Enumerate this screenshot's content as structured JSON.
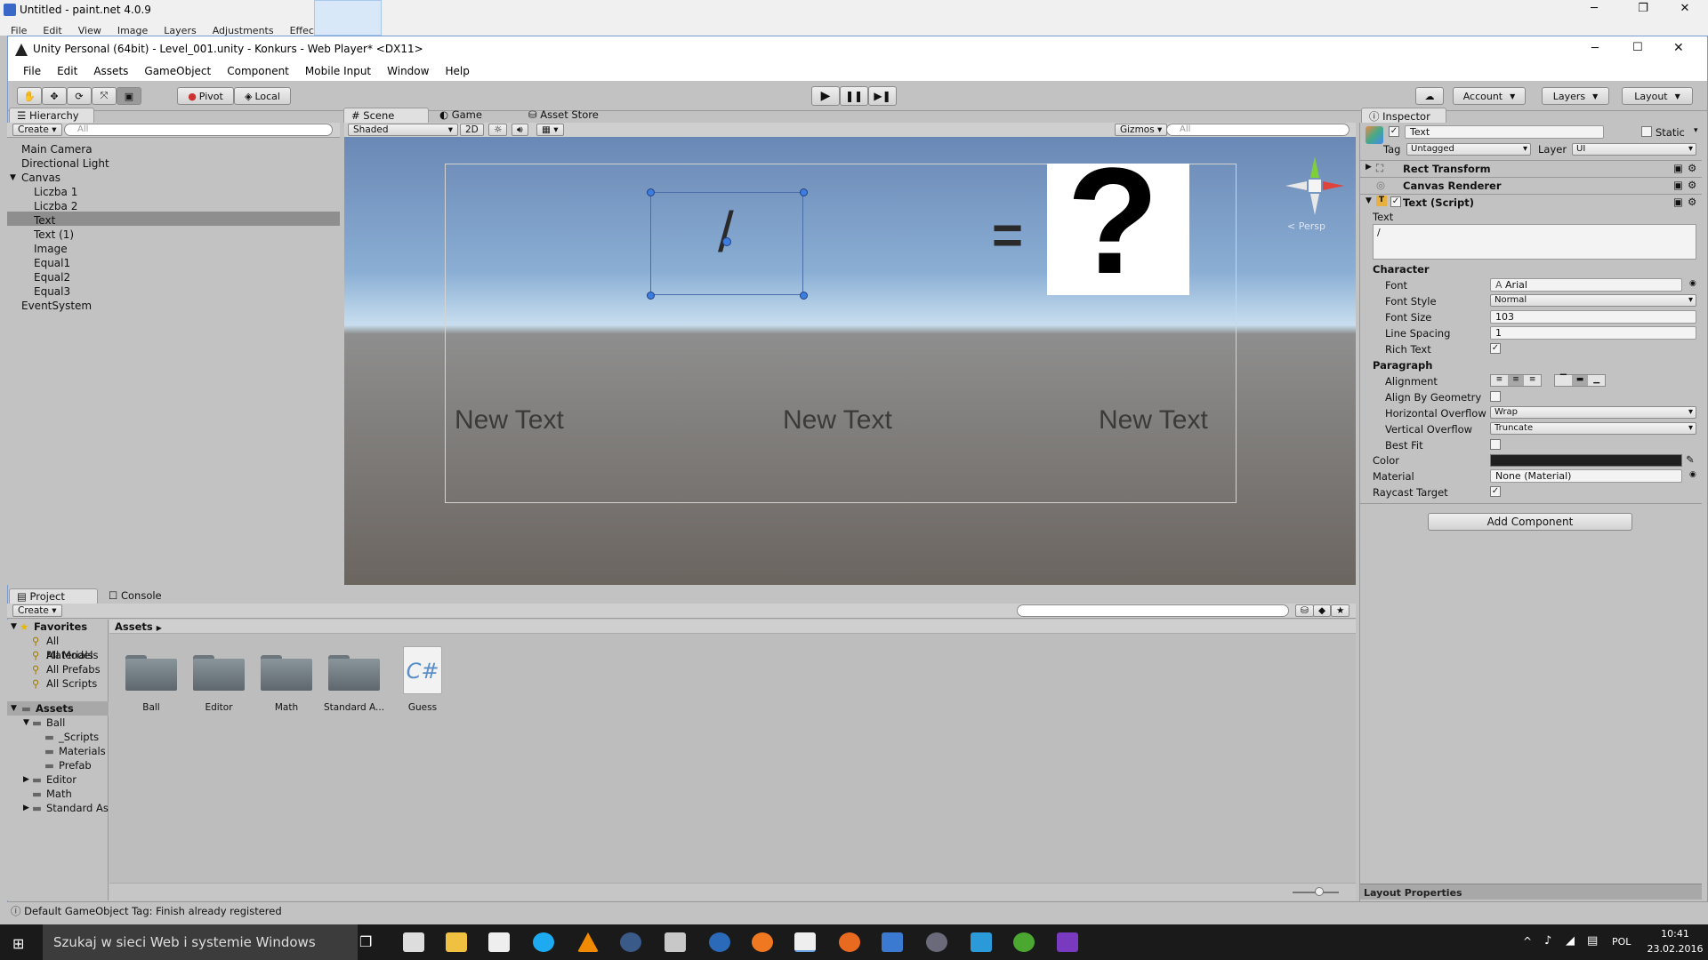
{
  "background_app": {
    "title": "Untitled - paint.net 4.0.9",
    "menu": [
      "File",
      "Edit",
      "View",
      "Image",
      "Layers",
      "Adjustments",
      "Effects"
    ]
  },
  "window": {
    "title": "Unity Personal (64bit) - Level_001.unity - Konkurs - Web Player* <DX11>"
  },
  "menubar": [
    "File",
    "Edit",
    "Assets",
    "GameObject",
    "Component",
    "Mobile Input",
    "Window",
    "Help"
  ],
  "toolbar": {
    "pivot": "Pivot",
    "local": "Local",
    "account": "Account",
    "layers": "Layers",
    "layout": "Layout"
  },
  "hierarchy": {
    "tab": "Hierarchy",
    "create": "Create",
    "search_placeholder": "All",
    "items": [
      {
        "label": "Main Camera",
        "indent": 0
      },
      {
        "label": "Directional Light",
        "indent": 0
      },
      {
        "label": "Canvas",
        "indent": 0
      },
      {
        "label": "Liczba 1",
        "indent": 1
      },
      {
        "label": "Liczba 2",
        "indent": 1
      },
      {
        "label": "Text",
        "indent": 1
      },
      {
        "label": "Text (1)",
        "indent": 1
      },
      {
        "label": "Image",
        "indent": 1
      },
      {
        "label": "Equal1",
        "indent": 1
      },
      {
        "label": "Equal2",
        "indent": 1
      },
      {
        "label": "Equal3",
        "indent": 1
      },
      {
        "label": "EventSystem",
        "indent": 0
      }
    ],
    "selected_index": 5
  },
  "scene": {
    "tabs": [
      "Scene",
      "Game",
      "Asset Store"
    ],
    "shading": "Shaded",
    "mode_2d": "2D",
    "gizmos": "Gizmos",
    "search_placeholder": "All",
    "persp_label": "Persp",
    "slash_text": "/",
    "equals_text": "=",
    "question_text": "?",
    "new_texts": [
      "New Text",
      "New Text",
      "New Text"
    ]
  },
  "inspector": {
    "tab": "Inspector",
    "object_name": "Text",
    "static_label": "Static",
    "tag_label": "Tag",
    "tag_value": "Untagged",
    "layer_label": "Layer",
    "layer_value": "UI",
    "components": [
      "Rect Transform",
      "Canvas Renderer",
      "Text (Script)"
    ],
    "text_label": "Text",
    "text_value": "/",
    "character_label": "Character",
    "font_label": "Font",
    "font_value": "Arial",
    "font_style_label": "Font Style",
    "font_style_value": "Normal",
    "font_size_label": "Font Size",
    "font_size_value": "103",
    "line_spacing_label": "Line Spacing",
    "line_spacing_value": "1",
    "rich_text_label": "Rich Text",
    "paragraph_label": "Paragraph",
    "alignment_label": "Alignment",
    "align_geometry_label": "Align By Geometry",
    "h_overflow_label": "Horizontal Overflow",
    "h_overflow_value": "Wrap",
    "v_overflow_label": "Vertical Overflow",
    "v_overflow_value": "Truncate",
    "best_fit_label": "Best Fit",
    "color_label": "Color",
    "material_label": "Material",
    "material_value": "None (Material)",
    "raycast_label": "Raycast Target",
    "add_component": "Add Component",
    "layout_properties": "Layout Properties"
  },
  "project": {
    "tabs": [
      "Project",
      "Console"
    ],
    "create": "Create",
    "favorites_label": "Favorites",
    "favorites": [
      "All Materials",
      "All Models",
      "All Prefabs",
      "All Scripts"
    ],
    "assets_label": "Assets",
    "tree": [
      {
        "label": "Ball",
        "indent": 1
      },
      {
        "label": "_Scripts",
        "indent": 2
      },
      {
        "label": "Materials",
        "indent": 2
      },
      {
        "label": "Prefab",
        "indent": 2
      },
      {
        "label": "Editor",
        "indent": 1
      },
      {
        "label": "Math",
        "indent": 1
      },
      {
        "label": "Standard As",
        "indent": 1
      }
    ],
    "breadcrumb": "Assets",
    "assets": [
      "Ball",
      "Editor",
      "Math",
      "Standard A...",
      "Guess"
    ]
  },
  "status_bar": "Default GameObject Tag: Finish already registered",
  "taskbar": {
    "search_placeholder": "Szukaj w sieci Web i systemie Windows",
    "language": "POL",
    "time": "10:41",
    "date": "23.02.2016"
  },
  "colors": {
    "unity_bg": "#c2c2c2",
    "selection": "#8e8e8e",
    "accent_blue": "#3e7de0"
  }
}
